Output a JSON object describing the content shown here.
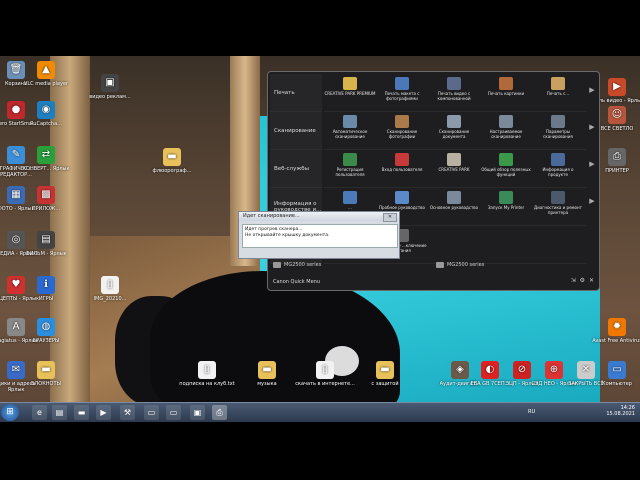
{
  "desktop": {
    "left_icons": [
      {
        "label": "Корзина",
        "icon": "recycle-bin-icon",
        "color": "#6c8fb5",
        "glyph": "🗑"
      },
      {
        "label": "VLC media player",
        "icon": "vlc-icon",
        "color": "#f08a00",
        "glyph": "▲"
      },
      {
        "label": "видео реклам...",
        "icon": "video-icon",
        "color": "#444",
        "glyph": "▣"
      },
      {
        "label": "Nero StartSma...",
        "icon": "nero-icon",
        "color": "#c0282b",
        "glyph": "●"
      },
      {
        "label": "RuCaptcha...",
        "icon": "rucaptcha-icon",
        "color": "#1e7fc0",
        "glyph": "◉"
      },
      {
        "label": "ГРАФИЧЕС... РЕДАКТОР...",
        "icon": "graphics-editor-icon",
        "color": "#3a8fd8",
        "glyph": "✎"
      },
      {
        "label": "КОНВЕРТ... Ярлык",
        "icon": "converter-icon",
        "color": "#2aa03a",
        "glyph": "⇄"
      },
      {
        "label": "ФОТО - Ярлык",
        "icon": "photo-icon",
        "color": "#3b6bb5",
        "glyph": "▦"
      },
      {
        "label": "ПРИЛОЖ...",
        "icon": "apps-icon",
        "color": "#c73333",
        "glyph": "▩"
      },
      {
        "label": "МЕДИА - Ярлык",
        "icon": "media-icon",
        "color": "#555",
        "glyph": "◎"
      },
      {
        "label": "ФИЛЬМ - Ярлык",
        "icon": "film-icon",
        "color": "#444",
        "glyph": "▤"
      },
      {
        "label": "РЕЦЕПТЫ - Ярлык",
        "icon": "recipes-icon",
        "color": "#d03030",
        "glyph": "♥"
      },
      {
        "label": "ИГРЫ",
        "icon": "games-icon",
        "color": "#2a6ad0",
        "glyph": "ℹ"
      },
      {
        "label": "plagiatus - Ярлык",
        "icon": "plagiatus-icon",
        "color": "#888",
        "glyph": "A"
      },
      {
        "label": "БРАУЗЕРЫ",
        "icon": "browsers-icon",
        "color": "#2b8fdf",
        "glyph": "◍"
      },
      {
        "label": "ящики и адреса - Ярлык",
        "icon": "mail-boxes-icon",
        "color": "#3a6ac8",
        "glyph": "✉"
      },
      {
        "label": "БЛОКНОТЫ",
        "icon": "notepads-folder-icon",
        "color": "#e8c15a",
        "glyph": "▬"
      }
    ],
    "middle_icons": [
      {
        "label": "флюорограф...",
        "icon": "folder-icon",
        "color": "#e8c15a",
        "glyph": "▬"
      },
      {
        "label": "IMG_20210...",
        "icon": "image-file-icon",
        "color": "#f2f2f2",
        "glyph": "▯"
      },
      {
        "label": "подписка на клуб.txt",
        "icon": "text-file-icon",
        "color": "#f2f2f2",
        "glyph": "▯"
      },
      {
        "label": "музыка",
        "icon": "music-folder-icon",
        "color": "#e8c15a",
        "glyph": "▬"
      },
      {
        "label": "скачать в интернете...",
        "icon": "document-icon",
        "color": "#f2f2f2",
        "glyph": "▯"
      },
      {
        "label": "с защитой",
        "icon": "protected-folder-icon",
        "color": "#e8c15a",
        "glyph": "▬"
      },
      {
        "label": "Аудит-двигат...",
        "icon": "audit-icon",
        "color": "#6a5a4a",
        "glyph": "◈"
      },
      {
        "label": "ЕВА GB 7СЕП...",
        "icon": "eva-icon",
        "color": "#d22",
        "glyph": "◐"
      },
      {
        "label": "ЭЦП - Ярлык",
        "icon": "signature-icon",
        "color": "#c22",
        "glyph": "⊘"
      },
      {
        "label": "СЭД НЕО - Ярлык",
        "icon": "sed-icon",
        "color": "#d33",
        "glyph": "⊕"
      },
      {
        "label": "ЗАКРЫТЬ ВСЁ",
        "icon": "close-all-icon",
        "color": "#ccc",
        "glyph": "✕"
      }
    ],
    "right_icons": [
      {
        "label": "грель видео - Ярлык",
        "icon": "video-shortcut-icon",
        "color": "#c84a2a",
        "glyph": "▶"
      },
      {
        "label": "ВСЕ СВЕТЛО",
        "icon": "portrait-icon",
        "color": "#b8553c",
        "glyph": "☺"
      },
      {
        "label": "ПРИНТЕР",
        "icon": "printer-icon",
        "color": "#666",
        "glyph": "⎙"
      },
      {
        "label": "Avast Free Antivirus",
        "icon": "avast-icon",
        "color": "#f07800",
        "glyph": "✹"
      },
      {
        "label": "Компьютер",
        "icon": "computer-icon",
        "color": "#3a7ad0",
        "glyph": "▭"
      }
    ]
  },
  "quick_menu": {
    "title": "Canon Quick Menu",
    "categories": [
      "Печать",
      "Сканирование",
      "Веб-службы",
      "Информация о руководстве и..."
    ],
    "rows": [
      [
        {
          "label": "CREATIVE PARK PREMIUM",
          "icon": "creative-park-premium-icon",
          "color": "#d8b44a"
        },
        {
          "label": "Печать макета с фотографиями",
          "icon": "photo-layout-print-icon",
          "color": "#4a78b8"
        },
        {
          "label": "Печать видео с компонованной",
          "icon": "video-print-icon",
          "color": "#5a6a8a"
        },
        {
          "label": "Печать картинки",
          "icon": "picture-print-icon",
          "color": "#b06a3a"
        },
        {
          "label": "Печать с...",
          "icon": "print-from-icon",
          "color": "#c8a060"
        }
      ],
      [
        {
          "label": "Автоматическое сканирование",
          "icon": "auto-scan-icon",
          "color": "#6a8aaa"
        },
        {
          "label": "Сканирование фотографии",
          "icon": "photo-scan-icon",
          "color": "#aa7a4a"
        },
        {
          "label": "Сканирование документа",
          "icon": "document-scan-icon",
          "color": "#8a9aaa"
        },
        {
          "label": "Настраиваемое сканирование",
          "icon": "custom-scan-icon",
          "color": "#7a8a9a"
        },
        {
          "label": "Параметры сканирования",
          "icon": "scan-settings-icon",
          "color": "#6a7a8a"
        }
      ],
      [
        {
          "label": "Регистрация пользователя",
          "icon": "user-registration-icon",
          "color": "#3a8a4a"
        },
        {
          "label": "Вход пользователя",
          "icon": "user-login-icon",
          "color": "#c83a3a"
        },
        {
          "label": "CREATIVE PARK",
          "icon": "creative-park-icon",
          "color": "#b8b0a0"
        },
        {
          "label": "Общий обзор полезных функций",
          "icon": "features-overview-icon",
          "color": "#3a9a4a"
        },
        {
          "label": "Информация о продукте",
          "icon": "product-info-icon",
          "color": "#4a6a9a"
        }
      ],
      [
        {
          "label": "...",
          "icon": "manual-icon",
          "color": "#4a7ab8"
        },
        {
          "label": "Пробное руководство",
          "icon": "trial-guide-icon",
          "color": "#5a8ac8"
        },
        {
          "label": "Основное руководство",
          "icon": "basic-guide-icon",
          "color": "#7a8a9a"
        },
        {
          "label": "Запуск My Printer",
          "icon": "my-printer-icon",
          "color": "#3a8a5a"
        },
        {
          "label": "Диагностика и ремонт принтера",
          "icon": "printer-diagnostics-icon",
          "color": "#4a5a6a"
        }
      ],
      [
        {
          "label": "...режима",
          "icon": "mode-icon",
          "color": "#555"
        },
        {
          "label": "...тические ...ключение питания",
          "icon": "power-icon",
          "color": "#666"
        }
      ]
    ],
    "printers": [
      "MG2500 series",
      "MG2500 series"
    ]
  },
  "scan_dialog": {
    "title": "Идет сканирование...",
    "line1": "Идет прогрев сканера...",
    "line2": "Не открывайте крышку документа."
  },
  "taskbar": {
    "language": "RU",
    "time": "14:26",
    "date": "15.08.2021"
  }
}
